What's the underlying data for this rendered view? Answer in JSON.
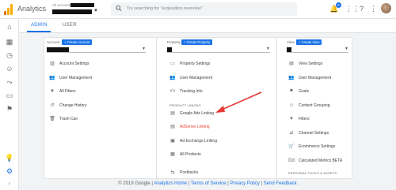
{
  "app": {
    "title": "Analytics"
  },
  "account_switcher": {
    "label": "All accounts"
  },
  "search": {
    "placeholder": "Try searching for \"acquisition overview\""
  },
  "header": {
    "notification_count": "5"
  },
  "tabs": [
    {
      "label": "ADMIN"
    },
    {
      "label": "USER"
    }
  ],
  "columns": {
    "account": {
      "label": "Account",
      "create": "+ Create Account"
    },
    "property": {
      "label": "Property",
      "create": "+ Create Property"
    },
    "view": {
      "label": "View",
      "create": "+ Create View"
    }
  },
  "account_items": [
    {
      "label": "Account Settings"
    },
    {
      "label": "User Management"
    },
    {
      "label": "All Filters"
    },
    {
      "label": "Change History"
    },
    {
      "label": "Trash Can"
    }
  ],
  "property_items": [
    {
      "label": "Property Settings"
    },
    {
      "label": "User Management"
    },
    {
      "label": "Tracking Info"
    }
  ],
  "product_linking": {
    "heading": "PRODUCT LINKING",
    "items": [
      {
        "label": "Google Ads Linking"
      },
      {
        "label": "AdSense Linking"
      },
      {
        "label": "Ad Exchange Linking"
      },
      {
        "label": "All Products"
      },
      {
        "label": "Postbacks"
      }
    ]
  },
  "view_items": [
    {
      "label": "View Settings"
    },
    {
      "label": "User Management"
    },
    {
      "label": "Goals"
    },
    {
      "label": "Content Grouping"
    },
    {
      "label": "Filters"
    },
    {
      "label": "Channel Settings"
    },
    {
      "label": "Ecommerce Settings"
    },
    {
      "label": "Calculated Metrics BETA"
    }
  ],
  "view_section": {
    "heading": "PERSONAL TOOLS & ASSETS"
  },
  "footer": {
    "copyright": "© 2019 Google",
    "links": [
      "Analytics Home",
      "Terms of Service",
      "Privacy Policy",
      "Send Feedback"
    ]
  },
  "colors": {
    "accent": "#1a73e8",
    "highlight": "#ea4335",
    "arrow": "#e53935"
  }
}
